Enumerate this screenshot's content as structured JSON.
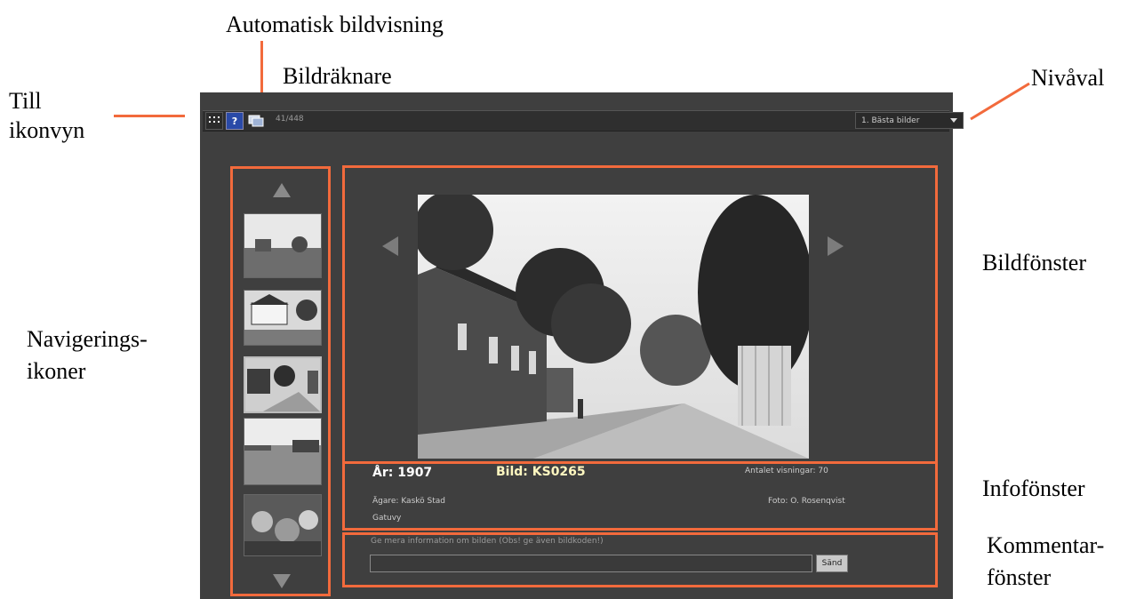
{
  "annotations": {
    "auto_show": "Automatisk bildvisning",
    "counter": "Bildräknare",
    "to_icon_view_1": "Till",
    "to_icon_view_2": "ikonvyn",
    "level": "Nivåval",
    "image_window": "Bildfönster",
    "nav_icons_1": "Navigerings-",
    "nav_icons_2": "ikoner",
    "info_window": "Infofönster",
    "comment_window_1": "Kommentar-",
    "comment_window_2": "fönster"
  },
  "toolbar": {
    "grid_icon": "grid-icon",
    "help_label": "?",
    "slideshow_icon": "slideshow-icon",
    "counter": "41/448",
    "level_select": "1. Bästa bilder"
  },
  "info": {
    "year": "År: 1907",
    "image_id": "Bild: KS0265",
    "views": "Antalet visningar: 70",
    "owner": "Ägare: Kaskö Stad",
    "photo": "Foto: O. Rosenqvist",
    "subject": "Gatuvy"
  },
  "comment": {
    "prompt": "Ge mera information om bilden (Obs! ge även bildkoden!)",
    "input_value": "",
    "send_label": "Sänd"
  },
  "colors": {
    "annotation_accent": "#f26a3c",
    "app_background": "#3f3f3f"
  }
}
